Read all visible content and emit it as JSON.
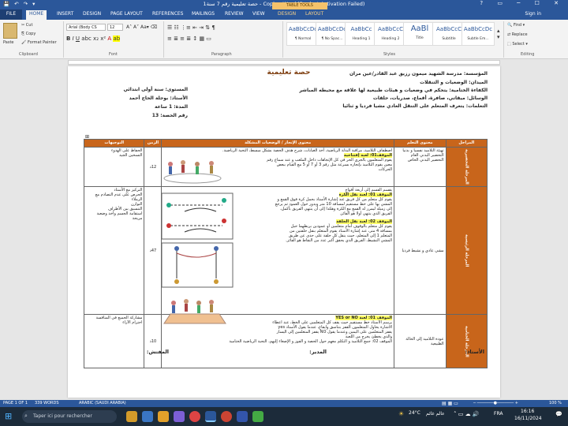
{
  "titlebar": {
    "quick_access": "💾 ↶ ↷ ▾",
    "title": "حصة تعليمية رقم 7 سنة1 - Copie - Word (Product Activation Failed)",
    "window_controls": "? ▭ ─ ☐ ✕"
  },
  "tabs": {
    "file": "FILE",
    "items": [
      "HOME",
      "INSERT",
      "DESIGN",
      "PAGE LAYOUT",
      "REFERENCES",
      "MAILINGS",
      "REVIEW",
      "VIEW",
      "DESIGN",
      "LAYOUT"
    ],
    "table_tools": "TABLE TOOLS",
    "sign_in": "Sign in"
  },
  "ribbon": {
    "clipboard": {
      "paste": "Paste",
      "cut": "Cut",
      "copy": "Copy",
      "format_painter": "Format Painter",
      "label": "Clipboard"
    },
    "font": {
      "name": "Arial (Body CS",
      "size": "12",
      "label": "Font"
    },
    "paragraph": {
      "label": "Paragraph"
    },
    "styles": {
      "items": [
        {
          "preview": "AaBbCcDc",
          "name": "¶ Normal"
        },
        {
          "preview": "AaBbCcDc",
          "name": "¶ No Spac..."
        },
        {
          "preview": "AaBbCc",
          "name": "Heading 1"
        },
        {
          "preview": "AaBbCcC",
          "name": "Heading 2"
        },
        {
          "preview": "AaBl",
          "name": "Title"
        },
        {
          "preview": "AaBbCcC",
          "name": "Subtitle"
        },
        {
          "preview": "AaBbCcDc",
          "name": "Subtle Em..."
        }
      ],
      "label": "Styles"
    },
    "editing": {
      "find": "Find",
      "replace": "Replace",
      "select": "Select",
      "label": "Editing"
    }
  },
  "doc": {
    "title": "حصة تعليمية",
    "header_right": [
      "المؤسسة: مدرسة الشهيد ميمون رزيق عبد القادر/عين مران",
      "الميدان: الوضعيات و التنقلات",
      "الكفاءة الختامية: يتحكم في وضعيات و هيئات طبيعية لها علاقة مع محيطه المباشر",
      "الوسائل: ميقاتي، صافرة، أقماع، صدريات، حلقات",
      "التعلمات: يتعرف المتعلم على التنقل العادي مشيا فرديا و ثنائيا"
    ],
    "header_left": [
      "المستوى: سنة أولى ابتدائي",
      "الأستاذ: بوجلة الحاج أحمد",
      "المدة: 1 ساعة",
      "رقم الحصة:         13"
    ],
    "table_headers": [
      "المراحل",
      "محتوى التعلم",
      "محتوى الإنجاز / الوضعيات المشكلة",
      "الزمن",
      "التوجيهات"
    ],
    "rows": [
      {
        "stage": "المرحلة التحضيرية",
        "goal": "تهيئة التلاميذ نفسيا و بدنيا\nالتحضير البدني العام\nالتحضير البدني الخاص",
        "content_lines": [
          "اصطفاف التلاميذ، مراقبة البذلة الرياضية، أخذ الغيابات، شرح هدف الحصة بشكل مبسط، التحية الرياضية.",
          "الموقف01: لعبة إفتتاحية",
          "يقوم المتعلمون بالجري الحر في كل الإتجاهات داخل الملعب و عند سماع رقم",
          "معين يقوم التلاميذ بإتجاره بسرعة مثل رقم 3 أو 7 أو 5 مع القيام ببعض",
          "الحركات"
        ],
        "time": "12د",
        "notes": "الحفاظ على الهدوء\nالتسخين الجيد"
      },
      {
        "stage": "المرحلة الرئيسية",
        "goal": "مشي عادي و نشيط فرديا",
        "content_lines": [
          "يقسم القسم إلى أربعة أفواج",
          "الموقف 01: لعبة نقل الكرة",
          "يقوم كل متعلم من كل فريق عند إشارة الأستاذ بحمل كرة فوق القمع و",
          "المشي بها على خط مستقيم لمسافة 10 متر ويدور حول العمود ثم يرجع",
          "إلى زميله ليمرر له القمع مع الكرة وهكذا إلى أن ينتهي الفريق بأكمل،",
          "الفريق الذي ينتهي أولا هو الفائز.",
          "الموقف 02: لعبة نقل الحلقة",
          "يقوم كل متعلم بالوقوف أمام متعلمين أو عمودين بربطهما حبل",
          "بمسافة 4 متر، عند إشارة الأستاذ يقوم المتعلم بنقل حلقتين من",
          "المتعلم 1 إلى المتعلم، حيث ينقل كل حلقة على حدى عن طريق",
          "المشي النشيط، الفريق الذي يحقق أكبر عدد من النقاط هو الفائز."
        ],
        "time": "47د",
        "notes": "التركيز مع الأستاذ\nالحرص على عدم التصادم مع الزملاء\nالتوازن\nالتنسيق بين الأطراف\nاستقامة الجسم وأخذ وضعية مريحة"
      },
      {
        "stage": "المرحلة الختامية",
        "goal": "عودة التلاميذ إلى الحالة الطبيعية",
        "content_lines": [
          "الموقف 01: لعبة YES or NO",
          "يرسم الأستاذ خط مستقيم حيث يقف كل المتعلمين على الخط، عند اعطاء",
          "الاشارة يحاول المتعلمون القفز بتناسق وايقاع، عندما يقول الأستاذ yes",
          "يقفز المتعلمين على اليمين وعندما يقول NO يقفز المتعلمين إلى اليسار",
          "والذي يخطئ يخرج من اللعبة",
          "الموقف 02: جمع التلاميذ و التكلم معهم حول الحصة و الفوز و الإصغاء إليهم، التحية الرياضية الختامية"
        ],
        "time": "10د",
        "notes": "مشاركة الجميع في المنافسة\nاحترام الآراء"
      }
    ],
    "signatures": [
      "الأستاذ:",
      "المدير:",
      "المفتش:"
    ]
  },
  "statusbar": {
    "page": "PAGE 1 OF 1",
    "words": "339 WORDS",
    "language": "ARABIC (SAUDI ARABIA)",
    "zoom": "100 %"
  },
  "taskbar": {
    "search_placeholder": "Taper ici pour rechercher",
    "weather": "24°C",
    "weather_label": "عالم غائم",
    "lang": "FRA",
    "time": "16:16",
    "date": "16/11/2024"
  }
}
